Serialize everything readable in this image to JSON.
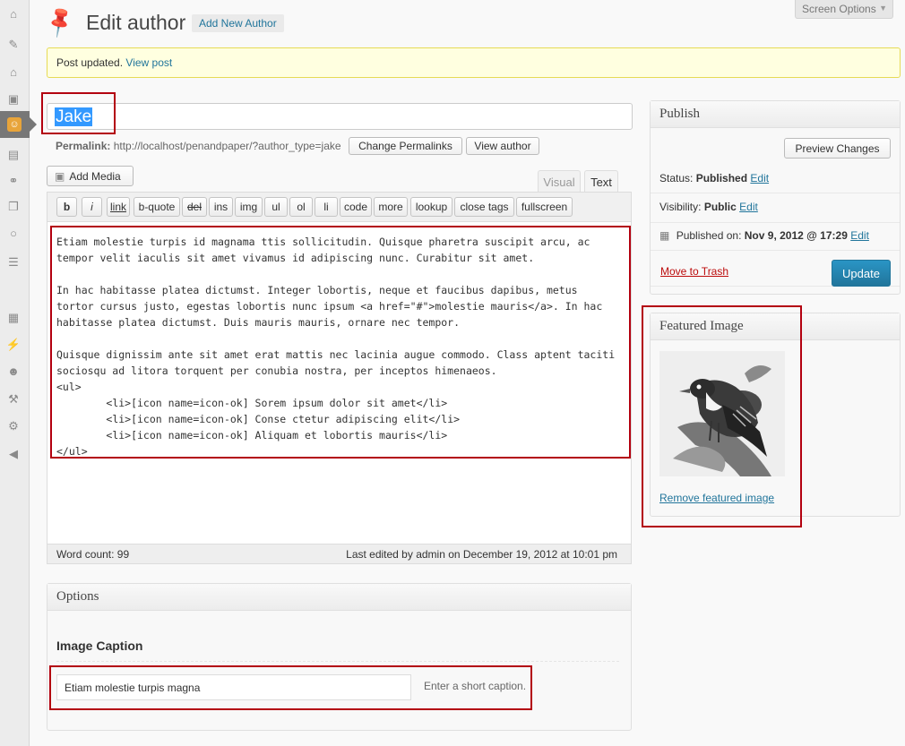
{
  "header": {
    "title": "Edit author",
    "add_new_label": "Add New Author",
    "screen_options_label": "Screen Options"
  },
  "notice": {
    "text": "Post updated.",
    "link_text": "View post"
  },
  "post": {
    "title": "Jake"
  },
  "permalink": {
    "label": "Permalink:",
    "url": "http://localhost/penandpaper/?author_type=jake",
    "change_button": "Change Permalinks",
    "view_button": "View author"
  },
  "editor": {
    "add_media_label": "Add Media",
    "tabs": {
      "visual": "Visual",
      "text": "Text"
    },
    "quicktags": [
      "b",
      "i",
      "link",
      "b-quote",
      "del",
      "ins",
      "img",
      "ul",
      "ol",
      "li",
      "code",
      "more",
      "lookup",
      "close tags",
      "fullscreen"
    ],
    "content": "Etiam molestie turpis id magnama ttis sollicitudin. Quisque pharetra suscipit arcu, ac\ntempor velit iaculis sit amet vivamus id adipiscing nunc. Curabitur sit amet.\n\nIn hac habitasse platea dictumst. Integer lobortis, neque et faucibus dapibus, metus\ntortor cursus justo, egestas lobortis nunc ipsum <a href=\"#\">molestie mauris</a>. In hac\nhabitasse platea dictumst. Duis mauris mauris, ornare nec tempor.\n\nQuisque dignissim ante sit amet erat mattis nec lacinia augue commodo. Class aptent taciti\nsociosqu ad litora torquent per conubia nostra, per inceptos himenaeos.\n<ul>\n        <li>[icon name=icon-ok] Sorem ipsum dolor sit amet</li>\n        <li>[icon name=icon-ok] Conse ctetur adipiscing elit</li>\n        <li>[icon name=icon-ok] Aliquam et lobortis mauris</li>\n</ul>",
    "word_count": "Word count: 99",
    "last_edited": "Last edited by admin on December 19, 2012 at 10:01 pm"
  },
  "options": {
    "title": "Options",
    "caption_label": "Image Caption",
    "caption_value": "Etiam molestie turpis magna",
    "caption_hint": "Enter a short caption."
  },
  "publish": {
    "title": "Publish",
    "preview_button": "Preview Changes",
    "status_label": "Status:",
    "status_value": "Published",
    "visibility_label": "Visibility:",
    "visibility_value": "Public",
    "published_label": "Published on:",
    "published_value": "Nov 9, 2012 @ 17:29",
    "edit_label": "Edit",
    "trash_label": "Move to Trash",
    "update_button": "Update"
  },
  "featured_image": {
    "title": "Featured Image",
    "remove_label": "Remove featured image"
  },
  "sidebar_icons": [
    "dashboard-icon",
    "posts-icon",
    "home-icon",
    "media-icon",
    "authors-icon",
    "gallery-icon",
    "links-icon",
    "pages-icon",
    "comments-icon",
    "feedback-icon",
    "appearance-icon",
    "plugins-icon",
    "users-icon",
    "tools-icon",
    "settings-icon",
    "collapse-icon"
  ],
  "colors": {
    "accent": "#21759b",
    "highlight_box": "#b3000f",
    "notice_bg": "#ffffe0"
  }
}
